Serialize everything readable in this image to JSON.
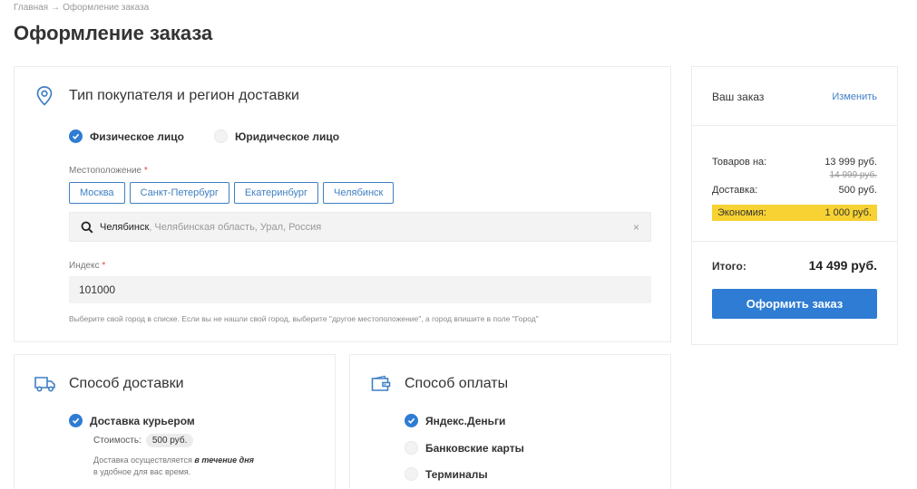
{
  "breadcrumb": {
    "home": "Главная",
    "separator": "→",
    "current": "Оформление заказа"
  },
  "page_title": "Оформление заказа",
  "buyer": {
    "title": "Тип покупателя и регион доставки",
    "icon": "location-pin-icon",
    "types": [
      {
        "label": "Физическое лицо",
        "selected": true
      },
      {
        "label": "Юридическое лицо",
        "selected": false
      }
    ],
    "location_label": "Местоположение",
    "required_mark": "*",
    "cities": [
      "Москва",
      "Санкт-Петербург",
      "Екатеринбург",
      "Челябинск"
    ],
    "search": {
      "city": "Челябинск",
      "region": ", Челябинская область, Урал, Россия",
      "clear": "×"
    },
    "index_label": "Индекс",
    "index_value": "101000",
    "hint": "Выберите свой город в списке. Если вы не нашли свой город, выберите \"другое местоположение\", а город впишите в поле \"Город\""
  },
  "summary": {
    "title": "Ваш заказ",
    "edit": "Изменить",
    "goods_label": "Товаров на:",
    "goods_value": "13 999 руб.",
    "goods_old_value": "14 999 руб.",
    "delivery_label": "Доставка:",
    "delivery_value": "500 руб.",
    "savings_label": "Экономия:",
    "savings_value": "1 000 руб.",
    "total_label": "Итого:",
    "total_value": "14 499 руб.",
    "order_button": "Оформить заказ"
  },
  "delivery": {
    "title": "Способ доставки",
    "icon": "truck-icon",
    "option_label": "Доставка курьером",
    "cost_label": "Стоимость:",
    "cost_value": "500 руб.",
    "note_part1": "Доставка осуществляется ",
    "note_em": "в течение дня",
    "note_part2": "в удобное для вас время."
  },
  "payment": {
    "title": "Способ оплаты",
    "icon": "wallet-icon",
    "options": [
      {
        "label": "Яндекс.Деньги",
        "selected": true
      },
      {
        "label": "Банковские карты",
        "selected": false
      },
      {
        "label": "Терминалы",
        "selected": false
      }
    ]
  },
  "colors": {
    "accent": "#2e7cd3",
    "savings": "#f7d232",
    "link": "#3f7fc4"
  }
}
